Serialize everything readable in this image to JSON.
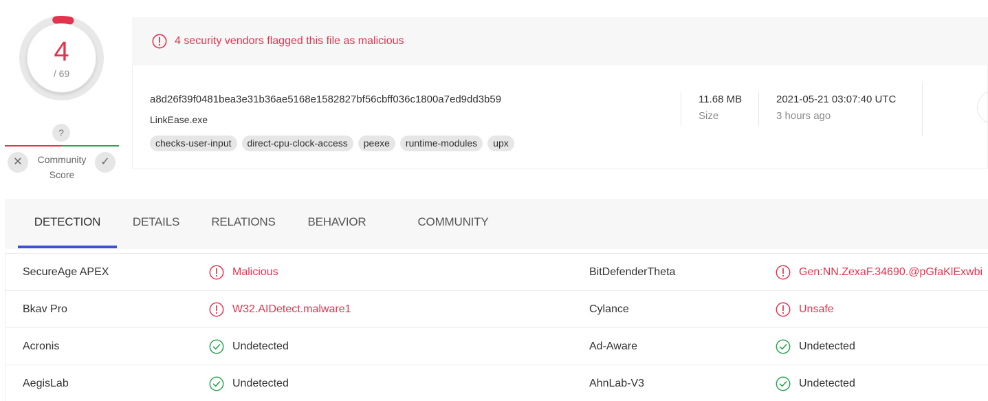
{
  "score": {
    "detections": "4",
    "total": "/ 69",
    "fraction_flagged": 0.058,
    "color": "#e3334f"
  },
  "community": {
    "unknown_glyph": "?",
    "label_line1": "Community",
    "label_line2": "Score",
    "negative_color": "#e3334f",
    "positive_color": "#2ba34f"
  },
  "alert": {
    "text": "4 security vendors flagged this file as malicious",
    "icon": "exclamation-circle-icon"
  },
  "file": {
    "hash": "a8d26f39f0481bea3e31b36ae5168e1582827bf56cbff036c1800a7ed9dd3b59",
    "name": "LinkEase.exe",
    "tags": [
      "checks-user-input",
      "direct-cpu-clock-access",
      "peexe",
      "runtime-modules",
      "upx"
    ],
    "size_value": "11.68 MB",
    "size_label": "Size",
    "date_value": "2021-05-21 03:07:40 UTC",
    "date_ago": "3 hours ago"
  },
  "tabs": [
    {
      "label": "DETECTION",
      "active": true
    },
    {
      "label": "DETAILS",
      "active": false
    },
    {
      "label": "RELATIONS",
      "active": false
    },
    {
      "label": "BEHAVIOR",
      "active": false
    },
    {
      "label": "COMMUNITY",
      "active": false
    }
  ],
  "accent_color": "#3b54d6",
  "detections": [
    {
      "left": {
        "vendor": "SecureAge APEX",
        "result": "Malicious",
        "status": "malicious"
      },
      "right": {
        "vendor": "BitDefenderTheta",
        "result": "Gen:NN.ZexaF.34690.@pGfaKlExwbi",
        "status": "malicious"
      }
    },
    {
      "left": {
        "vendor": "Bkav Pro",
        "result": "W32.AIDetect.malware1",
        "status": "malicious"
      },
      "right": {
        "vendor": "Cylance",
        "result": "Unsafe",
        "status": "malicious"
      }
    },
    {
      "left": {
        "vendor": "Acronis",
        "result": "Undetected",
        "status": "undetected"
      },
      "right": {
        "vendor": "Ad-Aware",
        "result": "Undetected",
        "status": "undetected"
      }
    },
    {
      "left": {
        "vendor": "AegisLab",
        "result": "Undetected",
        "status": "undetected"
      },
      "right": {
        "vendor": "AhnLab-V3",
        "result": "Undetected",
        "status": "undetected"
      }
    }
  ]
}
